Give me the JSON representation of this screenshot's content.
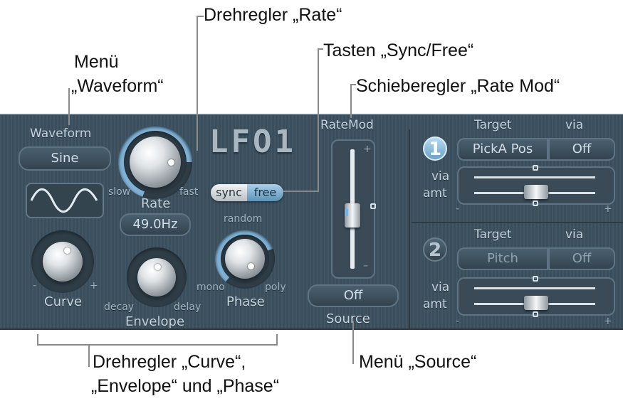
{
  "callouts": {
    "rate_knob": "Drehregler „Rate“",
    "waveform_menu_line1": "Menü",
    "waveform_menu_line2": "„Waveform“",
    "sync_free": "Tasten „Sync/Free“",
    "rate_mod": "Schieberegler „Rate Mod“",
    "knobs_line1": "Drehregler „Curve“,",
    "knobs_line2": "„Envelope“ und „Phase“",
    "source_menu": "Menü „Source“"
  },
  "panel": {
    "title": "LFO1",
    "waveform": {
      "label": "Waveform",
      "value": "Sine"
    },
    "rate": {
      "label": "Rate",
      "min_label": "slow",
      "max_label": "fast",
      "value": "49.0Hz"
    },
    "sync_button": "sync",
    "free_button": "free",
    "curve": {
      "label": "Curve",
      "minus": "-",
      "plus": "+"
    },
    "envelope": {
      "label": "Envelope",
      "min_label": "decay",
      "max_label": "delay"
    },
    "phase": {
      "label": "Phase",
      "top_label": "random",
      "min_label": "mono",
      "max_label": "poly"
    },
    "ratemod": {
      "label": "RateMod",
      "plus": "+",
      "minus": "–",
      "source_value": "Off",
      "source_label": "Source"
    },
    "routing": [
      {
        "number": "1",
        "target_header": "Target",
        "via_header": "via",
        "target_value": "PickA Pos",
        "via_value": "Off",
        "via_label": "via",
        "amt_label": "amt",
        "minus": "-",
        "plus": "+"
      },
      {
        "number": "2",
        "target_header": "Target",
        "via_header": "via",
        "target_value": "Pitch",
        "via_value": "Off",
        "via_label": "via",
        "amt_label": "amt",
        "minus": "-",
        "plus": "+"
      }
    ]
  },
  "colors": {
    "panel": "#3f5261",
    "label": "#c4d2dc",
    "accent": "#7fb2d6",
    "free_active": "#8ab8d8"
  }
}
